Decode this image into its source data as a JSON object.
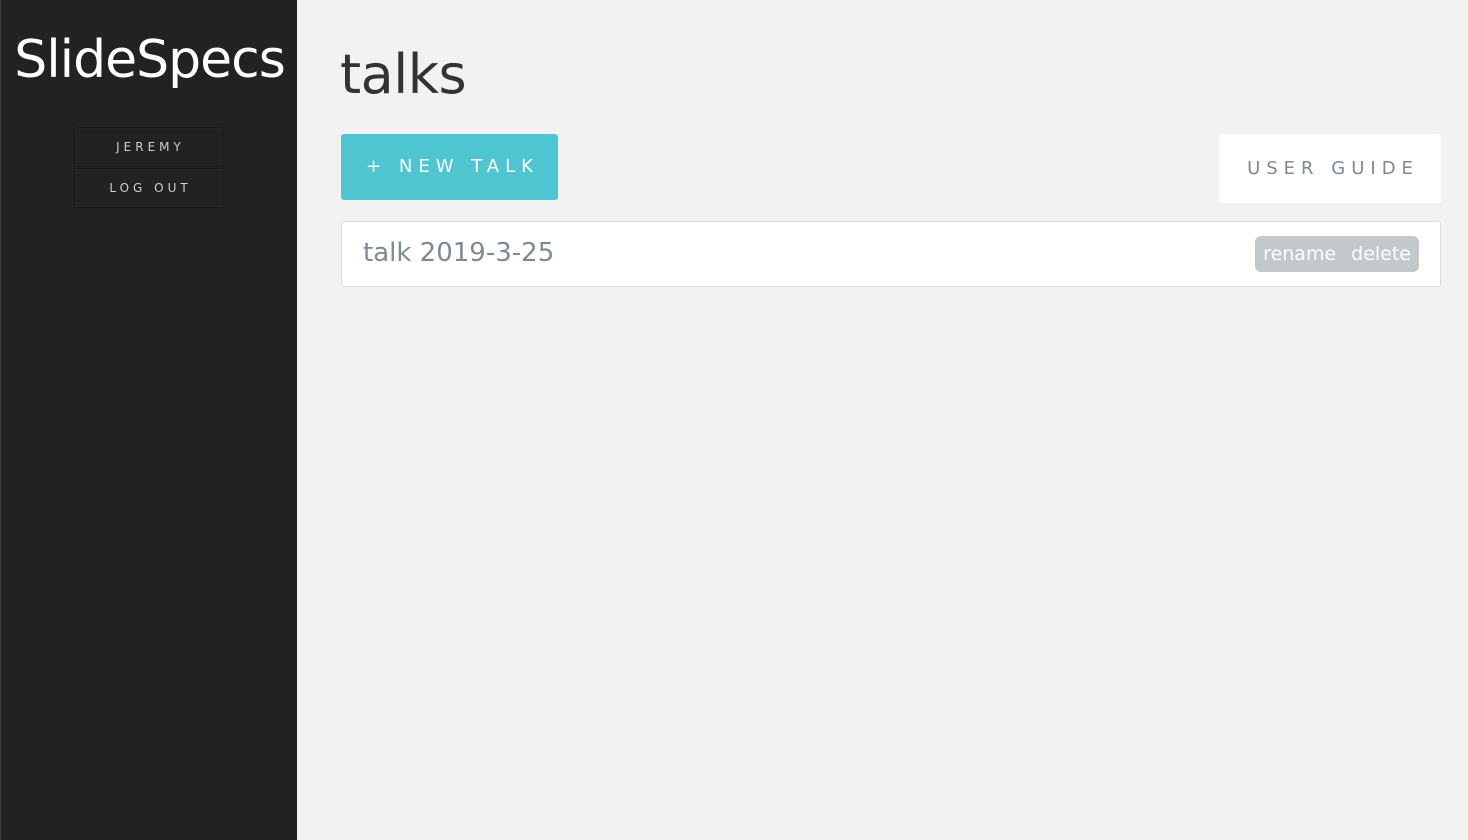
{
  "sidebar": {
    "brand": "SlideSpecs",
    "nav": [
      {
        "label": "JEREMY"
      },
      {
        "label": "LOG OUT"
      }
    ]
  },
  "main": {
    "title": "talks",
    "new_talk_label": "+ NEW TALK",
    "user_guide_label": "USER GUIDE",
    "talks": [
      {
        "title": "talk 2019-3-25",
        "actions": [
          "rename",
          "delete"
        ]
      }
    ]
  },
  "colors": {
    "sidebar_bg": "#222222",
    "page_bg": "#f2f2f2",
    "accent": "#4fc5d2",
    "muted_text": "#7c8a93",
    "action_bg": "#c3c8cb"
  }
}
